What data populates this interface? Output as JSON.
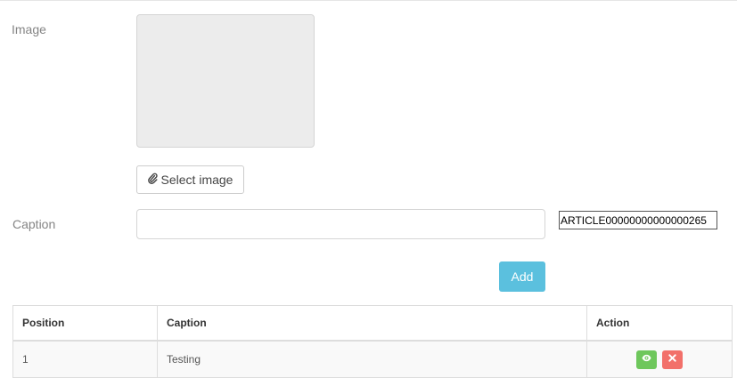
{
  "form": {
    "image_label": "Image",
    "select_image_label": "Select image",
    "caption_label": "Caption",
    "caption_value": "",
    "article_id": "ARTICLE00000000000000265",
    "add_label": "Add"
  },
  "table": {
    "headers": {
      "position": "Position",
      "caption": "Caption",
      "action": "Action"
    },
    "rows": [
      {
        "position": "1",
        "caption": "Testing",
        "actions": [
          "eye-icon",
          "close-icon"
        ]
      }
    ]
  },
  "colors": {
    "add_button": "#5bc0de",
    "view_button": "#6ec75c",
    "delete_button": "#f2706a"
  }
}
